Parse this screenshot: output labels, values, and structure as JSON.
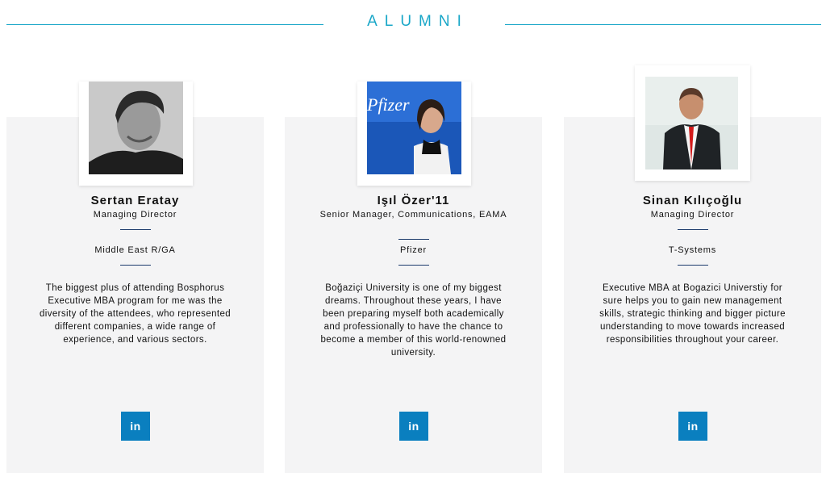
{
  "section": {
    "title": "ALUMNI"
  },
  "colors": {
    "accent": "#1aa7c8",
    "linkedin": "#0a7fbf",
    "card_bg": "#f4f4f5",
    "separator": "#1b3a6b"
  },
  "cards": [
    {
      "name": "Sertan Eratay",
      "role": "Managing Director",
      "company": "Middle East R/GA",
      "quote": "The biggest plus of attending Bosphorus Executive MBA program for me was the diversity of the attendees, who represented different companies, a wide range of experience, and various sectors.",
      "linkedin_label": "in",
      "photo_icon": "portrait-photo"
    },
    {
      "name": "Işıl Özer'11",
      "role": "Senior Manager, Communications, EAMA",
      "company": "Pfizer",
      "quote": "Boğaziçi University is one of my biggest dreams. Throughout these years, I have been preparing myself both academically and professionally to have the chance to become a member of this world-renowned university.",
      "linkedin_label": "in",
      "photo_icon": "portrait-photo",
      "photo_logo_text": "Pfizer"
    },
    {
      "name": "Sinan Kılıçoğlu",
      "role": "Managing Director",
      "company": "T-Systems",
      "quote": "Executive MBA at Bogazici Universtiy for sure helps you to gain new management skills, strategic thinking and bigger picture understanding to move towards increased responsibilities throughout your career.",
      "linkedin_label": "in",
      "photo_icon": "portrait-photo"
    }
  ]
}
